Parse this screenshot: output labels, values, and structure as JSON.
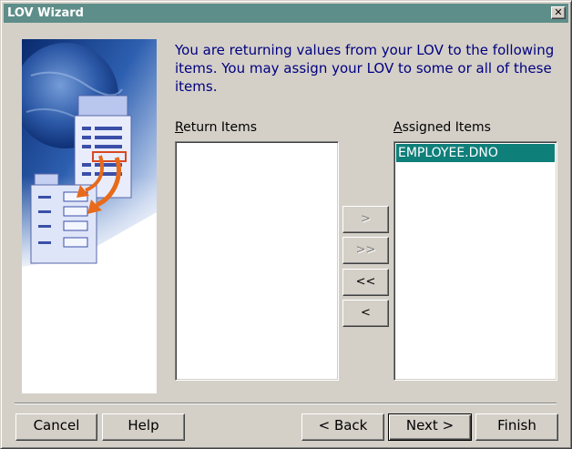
{
  "window": {
    "title": "LOV Wizard",
    "close_glyph": "✕"
  },
  "prompt": "You are returning values from your LOV to the following items. You may assign your LOV to some or all of these items.",
  "return_items": {
    "label_accel": "R",
    "label_rest": "eturn Items",
    "items": []
  },
  "assigned_items": {
    "label_accel": "A",
    "label_rest": "ssigned Items",
    "items": [
      {
        "label": "EMPLOYEE.DNO",
        "selected": true
      }
    ]
  },
  "move_buttons": {
    "add": ">",
    "add_all": ">>",
    "remove_all": "<<",
    "remove": "<"
  },
  "footer": {
    "cancel": "Cancel",
    "help": "Help",
    "back": "< Back",
    "next": "Next >",
    "finish": "Finish"
  },
  "colors": {
    "titlebar": "#5e8e8a",
    "prompt_text": "#00007f",
    "selection": "#0f7f7a"
  },
  "icons": {
    "wizard_art": "forms-transfer-illustration",
    "close": "close-icon"
  }
}
